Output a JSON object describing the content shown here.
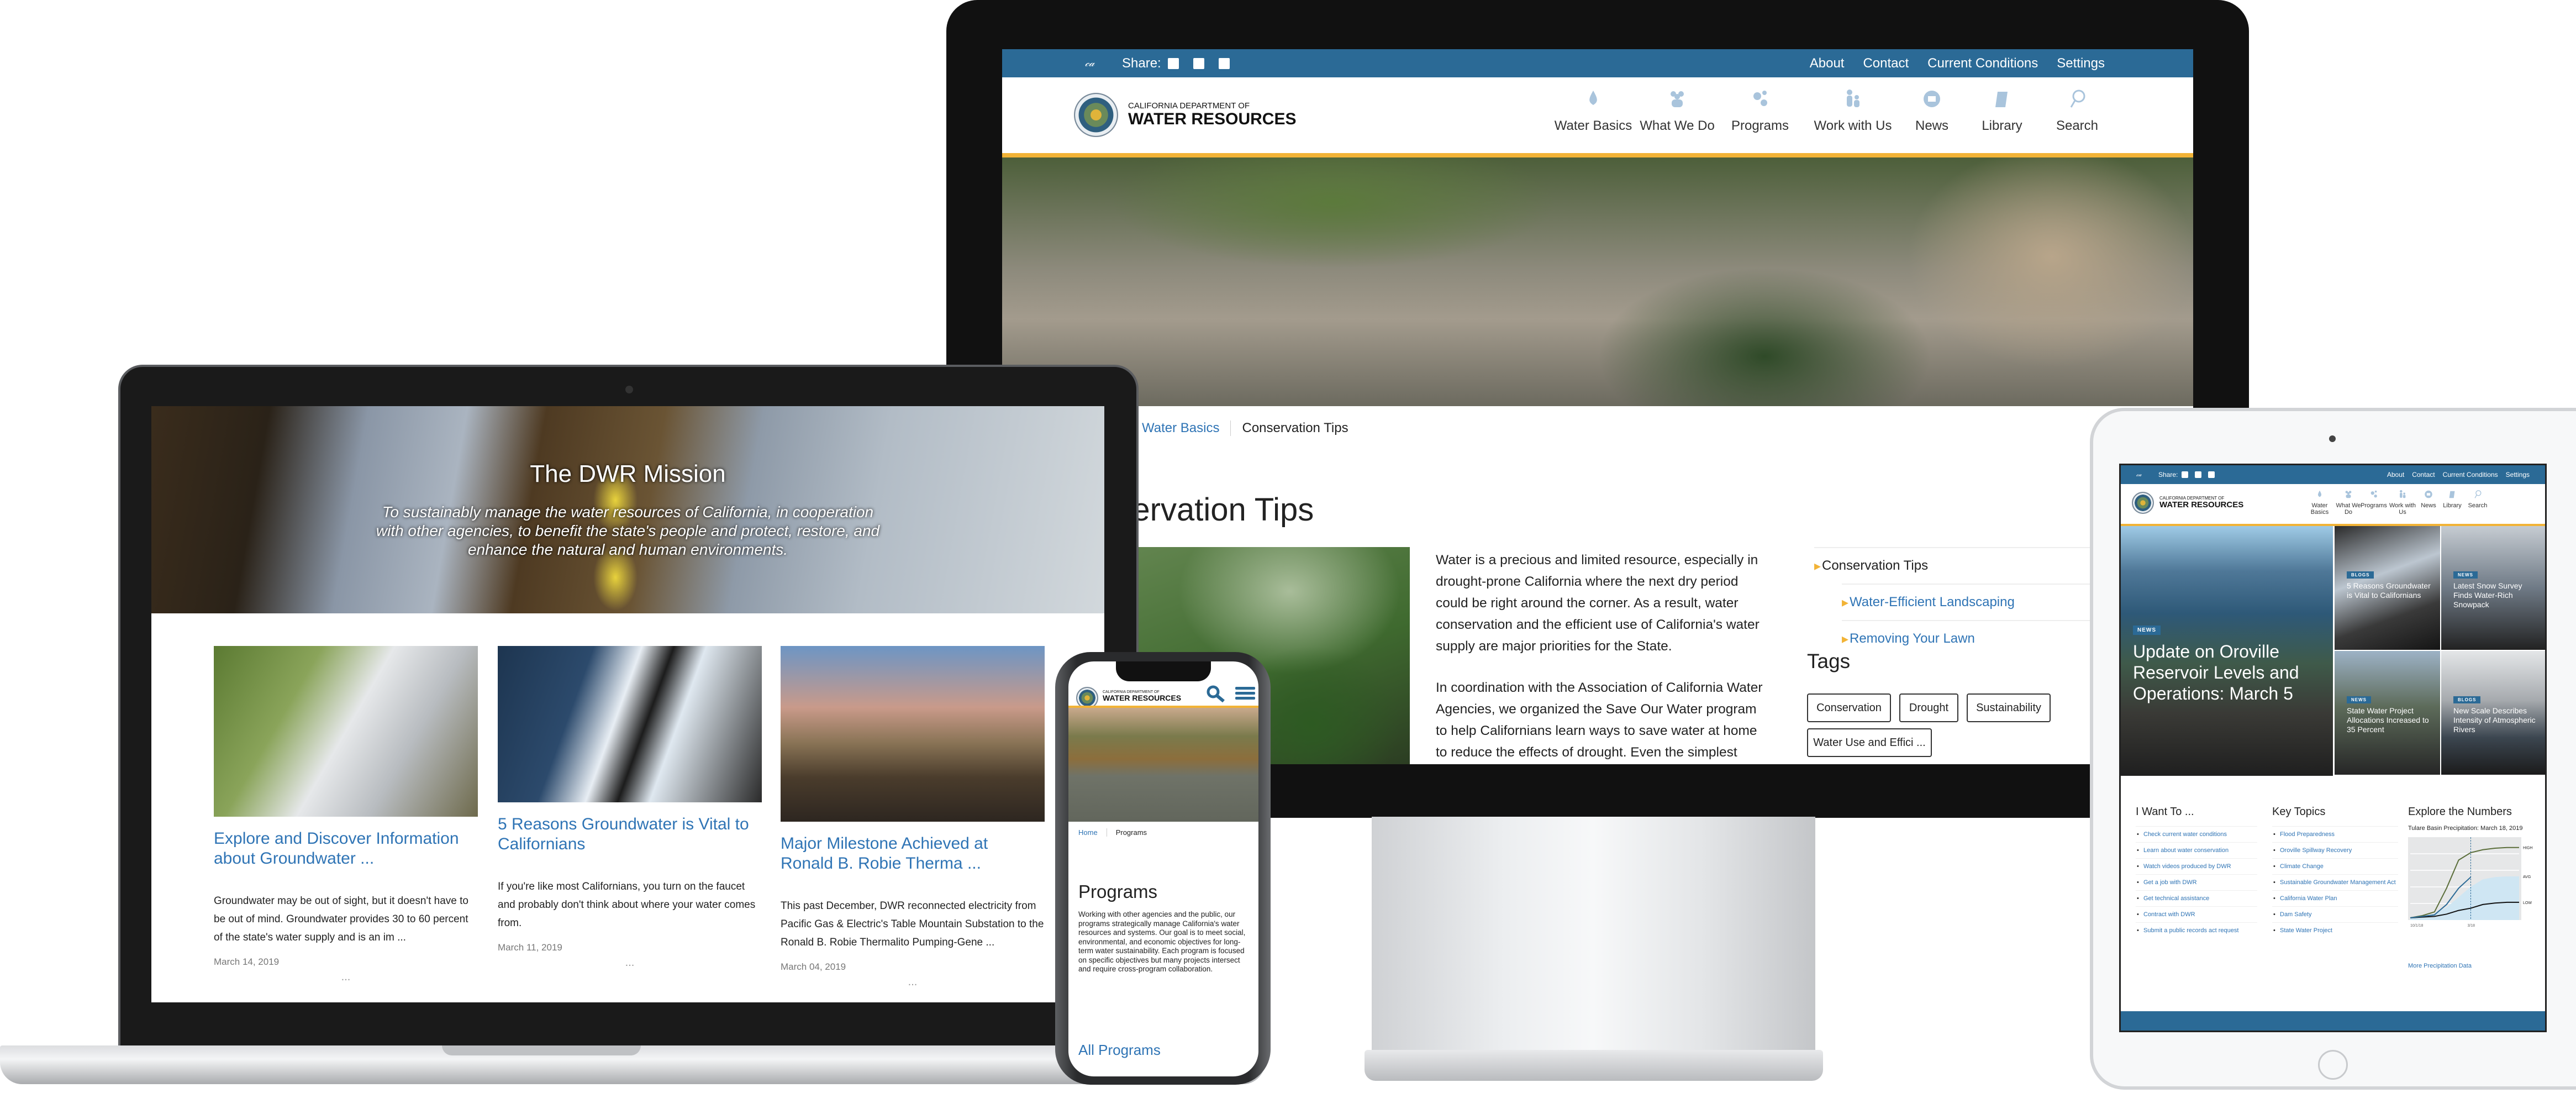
{
  "colors": {
    "brand_blue": "#2b6a96",
    "link_blue": "#2f74b5",
    "accent_gold": "#f2b336",
    "nav_icon": "#a9c4dc"
  },
  "brand": {
    "line1": "CALIFORNIA DEPARTMENT OF",
    "line2": "WATER RESOURCES"
  },
  "topbar": {
    "share_label": "Share:",
    "share_icons": [
      "facebook-icon",
      "twitter-icon",
      "google-plus-icon"
    ],
    "links": [
      "About",
      "Contact",
      "Current Conditions",
      "Settings"
    ]
  },
  "nav": [
    {
      "label": "Water Basics",
      "icon": "water-drop-icon"
    },
    {
      "label": "What We Do",
      "icon": "people-group-icon"
    },
    {
      "label": "Programs",
      "icon": "gears-icon"
    },
    {
      "label": "Work with Us",
      "icon": "people-icon"
    },
    {
      "label": "News",
      "icon": "calendar-icon"
    },
    {
      "label": "Library",
      "icon": "book-icon"
    },
    {
      "label": "Search",
      "icon": "search-icon"
    }
  ],
  "desktop": {
    "breadcrumb": [
      "Water Basics",
      "Conservation Tips"
    ],
    "title": "Conservation Tips",
    "paragraphs": [
      "Water is a precious and limited resource, especially in drought-prone California where the next dry period could be right around the corner. As a result, water conservation and the efficient use of California's water supply are major priorities for the State.",
      "In coordination with the Association of California Water Agencies, we organized the Save Our Water program to help Californians learn ways to save water at home to reduce the effects of drought. Even the simplest changes to daily routines can have a significant impact. By making conservation a way of life in California, we save water,"
    ],
    "sidenav": {
      "current": "Conservation Tips",
      "children": [
        "Water-Efficient Landscaping",
        "Removing Your Lawn"
      ]
    },
    "tags_heading": "Tags",
    "tags": [
      "Conservation",
      "Drought",
      "Sustainability",
      "Water Use and Effici ..."
    ]
  },
  "laptop": {
    "hero_title": "The DWR Mission",
    "hero_text": "To sustainably manage the water resources of California, in cooperation with other agencies, to benefit the state's people and protect, restore, and enhance the natural and human environments.",
    "cards": [
      {
        "title": "Explore and Discover Information about Groundwater ...",
        "desc": "Groundwater may be out of sight, but it doesn't have to be out of mind. Groundwater provides 30 to 60 percent of the state's water supply and is an im ...",
        "date": "March 14, 2019",
        "more": "..."
      },
      {
        "title": "5 Reasons Groundwater is Vital to Californians",
        "desc": "If you're like most Californians, you turn on the faucet and probably don't think about where your water comes from.",
        "date": "March 11, 2019",
        "more": "..."
      },
      {
        "title": "Major Milestone Achieved at Ronald B. Robie Therma ...",
        "desc": "This past December, DWR reconnected electricity from Pacific Gas & Electric's Table Mountain Substation to the Ronald B. Robie Thermalito Pumping-Gene ...",
        "date": "March 04, 2019",
        "more": "..."
      }
    ]
  },
  "phone": {
    "breadcrumb": [
      "Home",
      "Programs"
    ],
    "title": "Programs",
    "text": "Working with other agencies and the public, our programs strategically manage California's water resources and systems. Our goal is to meet social, environmental, and economic objectives for long-term water sustainability. Each program is focused on specific objectives but many projects intersect and require cross-program collaboration.",
    "link": "All Programs"
  },
  "tablet": {
    "feature": {
      "badge": "NEWS",
      "title": "Update on Oroville Reservoir Levels and Operations: March 5"
    },
    "tiles": [
      {
        "badge": "BLOGS",
        "title": "5 Reasons Groundwater is Vital to Californians"
      },
      {
        "badge": "NEWS",
        "title": "Latest Snow Survey Finds Water-Rich Snowpack"
      },
      {
        "badge": "NEWS",
        "title": "State Water Project Allocations Increased to 35 Percent"
      },
      {
        "badge": "BLOGS",
        "title": "New Scale Describes Intensity of Atmospheric Rivers"
      }
    ],
    "i_want_to": {
      "heading": "I Want To ...",
      "items": [
        "Check current water conditions",
        "Learn about water conservation",
        "Watch videos produced by DWR",
        "Get a job with DWR",
        "Get technical assistance",
        "Contract with DWR",
        "Submit a public records act request"
      ]
    },
    "key_topics": {
      "heading": "Key Topics",
      "items": [
        "Flood Preparedness",
        "Oroville Spillway Recovery",
        "Climate Change",
        "Sustainable Groundwater Management Act",
        "California Water Plan",
        "Dam Safety",
        "State Water Project"
      ]
    },
    "numbers": {
      "heading": "Explore the Numbers",
      "chart_title": "Tulare Basin Precipitation: March 18, 2019",
      "link": "More Precipitation Data"
    }
  },
  "chart_data": {
    "type": "line",
    "title": "Tulare Basin Precipitation: March 18, 2019",
    "x_tick_labels": [
      "10/1/18",
      "3/18"
    ],
    "line_labels": [
      "HIGH",
      "AVG",
      "LOW"
    ],
    "grid": true,
    "series": [
      {
        "name": "HIGH",
        "color": "#5b6e3a",
        "values": [
          0,
          3,
          8,
          40,
          78,
          88,
          92,
          94,
          95,
          95
        ]
      },
      {
        "name": "AVG",
        "color": "#cfe6f3",
        "values": [
          0,
          2,
          6,
          14,
          28,
          42,
          52,
          55,
          56,
          56
        ]
      },
      {
        "name": "LOW",
        "color": "#111111",
        "values": [
          0,
          1,
          2,
          5,
          10,
          13,
          18,
          20,
          21,
          21
        ]
      },
      {
        "name": "",
        "color": "#2b6a96",
        "values": [
          0,
          2,
          4,
          18,
          40,
          55
        ]
      }
    ]
  }
}
